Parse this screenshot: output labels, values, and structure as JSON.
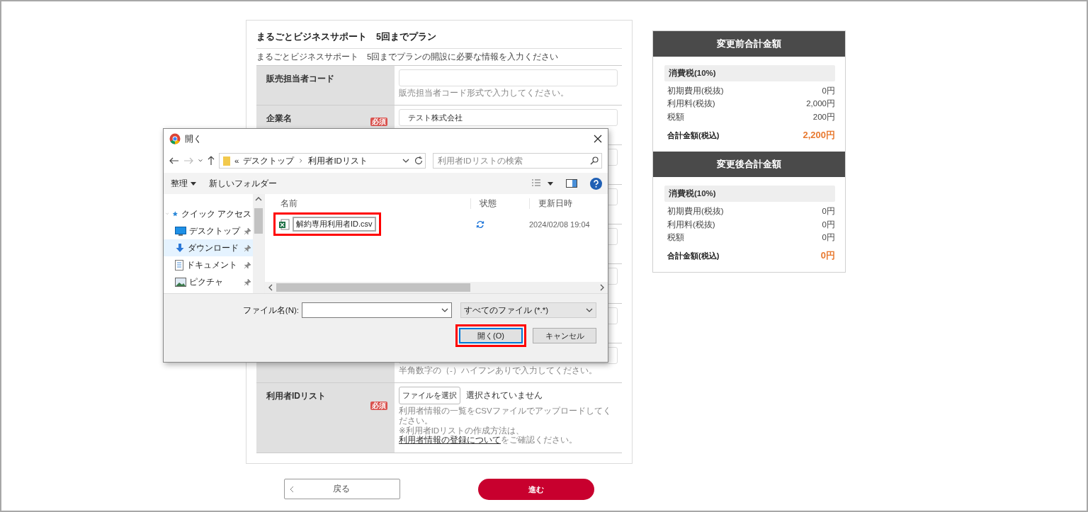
{
  "form": {
    "title": "まるごとビジネスサポート　5回までプラン",
    "description": "まるごとビジネスサポート　5回までプランの開設に必要な情報を入力ください",
    "rows": [
      {
        "kind": "field",
        "label": "販売担当者コード",
        "value": "",
        "hint": "販売担当者コード形式で入力してください。"
      },
      {
        "kind": "field",
        "label": "企業名",
        "badge": "必須",
        "value": "テスト株式会社"
      },
      {
        "kind": "covered"
      },
      {
        "kind": "covered"
      },
      {
        "kind": "covered"
      },
      {
        "kind": "covered"
      },
      {
        "kind": "covered"
      },
      {
        "kind": "covered",
        "hint": "半角数字の（-）ハイフンありで入力してください。"
      },
      {
        "kind": "file",
        "label": "利用者IDリスト",
        "badge": "必須",
        "button": "ファイルを選択",
        "status": "選択されていません",
        "notes": [
          "利用者情報の一覧をCSVファイルでアップロードしてください。"
        ],
        "note_before": "※利用者IDリストの作成方法は、",
        "link": "利用者情報の登録について",
        "note_after": "をご確認ください。"
      }
    ]
  },
  "buttons": {
    "back": "戻る",
    "next": "進む"
  },
  "summaries": [
    {
      "title": "変更前合計金額",
      "tax_heading": "消費税(10%)",
      "lines": [
        {
          "label": "初期費用(税抜)",
          "value": "0円"
        },
        {
          "label": "利用料(税抜)",
          "value": "2,000円"
        },
        {
          "label": "税額",
          "value": "200円"
        }
      ],
      "total_label": "合計金額(税込)",
      "total": "2,200円"
    },
    {
      "title": "変更後合計金額",
      "tax_heading": "消費税(10%)",
      "lines": [
        {
          "label": "初期費用(税抜)",
          "value": "0円"
        },
        {
          "label": "利用料(税抜)",
          "value": "0円"
        },
        {
          "label": "税額",
          "value": "0円"
        }
      ],
      "total_label": "合計金額(税込)",
      "total": "0円"
    }
  ],
  "dialog": {
    "title": "開く",
    "path": [
      "デスクトップ",
      "利用者IDリスト"
    ],
    "path_prefix": "«",
    "search_placeholder": "利用者IDリストの検索",
    "toolbar": {
      "organize": "整理",
      "new_folder": "新しいフォルダー"
    },
    "nav": [
      {
        "kind": "group",
        "label": "クイック アクセス",
        "selected": false
      },
      {
        "kind": "desktop",
        "label": "デスクトップ",
        "selected": false
      },
      {
        "kind": "download",
        "label": "ダウンロード",
        "selected": true
      },
      {
        "kind": "document",
        "label": "ドキュメント",
        "selected": false
      },
      {
        "kind": "picture",
        "label": "ピクチャ",
        "selected": false
      }
    ],
    "columns": [
      "名前",
      "状態",
      "更新日時"
    ],
    "files": [
      {
        "name": "解約専用利用者ID.csv",
        "date": "2024/02/08 19:04",
        "highlighted": true
      }
    ],
    "filename_label": "ファイル名(N):",
    "filter": "すべてのファイル (*.*)",
    "open_button": {
      "label": "開く(O)",
      "highlighted": true
    },
    "cancel_button": "キャンセル"
  }
}
